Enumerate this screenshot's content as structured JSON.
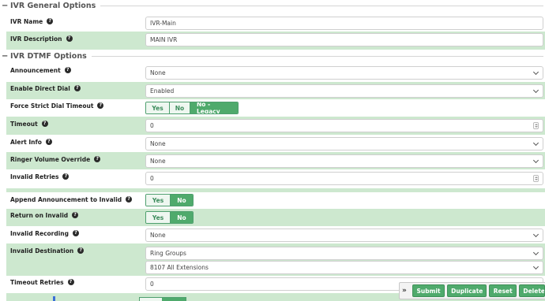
{
  "general": {
    "title": "IVR General Options",
    "toggle": "−",
    "name_label": "IVR Name",
    "name_value": "IVR-Main",
    "description_label": "IVR Description",
    "description_value": "MAIN IVR"
  },
  "dtmf": {
    "title": "IVR DTMF Options",
    "toggle": "−",
    "announcement_label": "Announcement",
    "announcement_value": "None",
    "direct_dial_label": "Enable Direct Dial",
    "direct_dial_value": "Enabled",
    "strict_timeout_label": "Force Strict Dial Timeout",
    "strict_timeout_options": [
      "Yes",
      "No",
      "No - Legacy"
    ],
    "strict_timeout_selected": "No - Legacy",
    "timeout_label": "Timeout",
    "timeout_value": "0",
    "alert_info_label": "Alert Info",
    "alert_info_value": "None",
    "ringer_label": "Ringer Volume Override",
    "ringer_value": "None",
    "invalid_retries_label": "Invalid Retries",
    "invalid_retries_value": "0",
    "append_label": "Append Announcement to Invalid",
    "append_options": [
      "Yes",
      "No"
    ],
    "append_selected": "No",
    "return_label": "Return on Invalid",
    "return_options": [
      "Yes",
      "No"
    ],
    "return_selected": "No",
    "invalid_recording_label": "Invalid Recording",
    "invalid_recording_value": "None",
    "invalid_destination_label": "Invalid Destination",
    "invalid_destination_type": "Ring Groups",
    "invalid_destination_target": "8107 All Extensions",
    "timeout_retries_label": "Timeout Retries",
    "timeout_retries_value": "0"
  },
  "actions": {
    "expand": "»",
    "submit": "Submit",
    "duplicate": "Duplicate",
    "reset": "Reset",
    "delete": "Delete"
  },
  "help_glyph": "?",
  "colors": {
    "accent": "#4faa6c",
    "row_shade": "#cde8cf"
  }
}
